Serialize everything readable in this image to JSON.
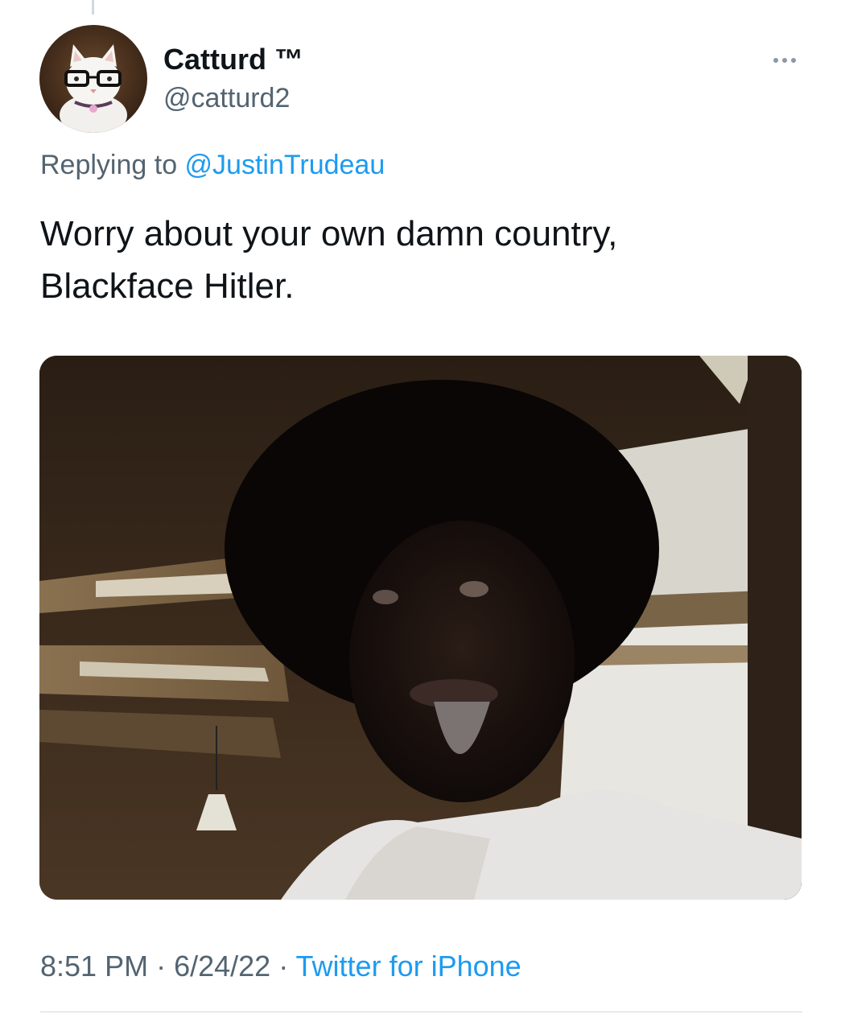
{
  "tweet": {
    "author": {
      "display_name": "Catturd ™",
      "handle": "@catturd2",
      "avatar_icon": "cat-with-glasses-avatar"
    },
    "reply_prefix": "Replying to ",
    "reply_to": "@JustinTrudeau",
    "text_line1": "Worry about your own damn country,",
    "text_line2": "Blackface Hitler.",
    "time": "8:51 PM",
    "separator": " · ",
    "date": "6/24/22",
    "source": "Twitter for iPhone",
    "more_icon": "more-dots-icon"
  },
  "colors": {
    "text_primary": "#0f1419",
    "text_secondary": "#536471",
    "link": "#1d9bf0",
    "divider": "#cfd9de"
  }
}
